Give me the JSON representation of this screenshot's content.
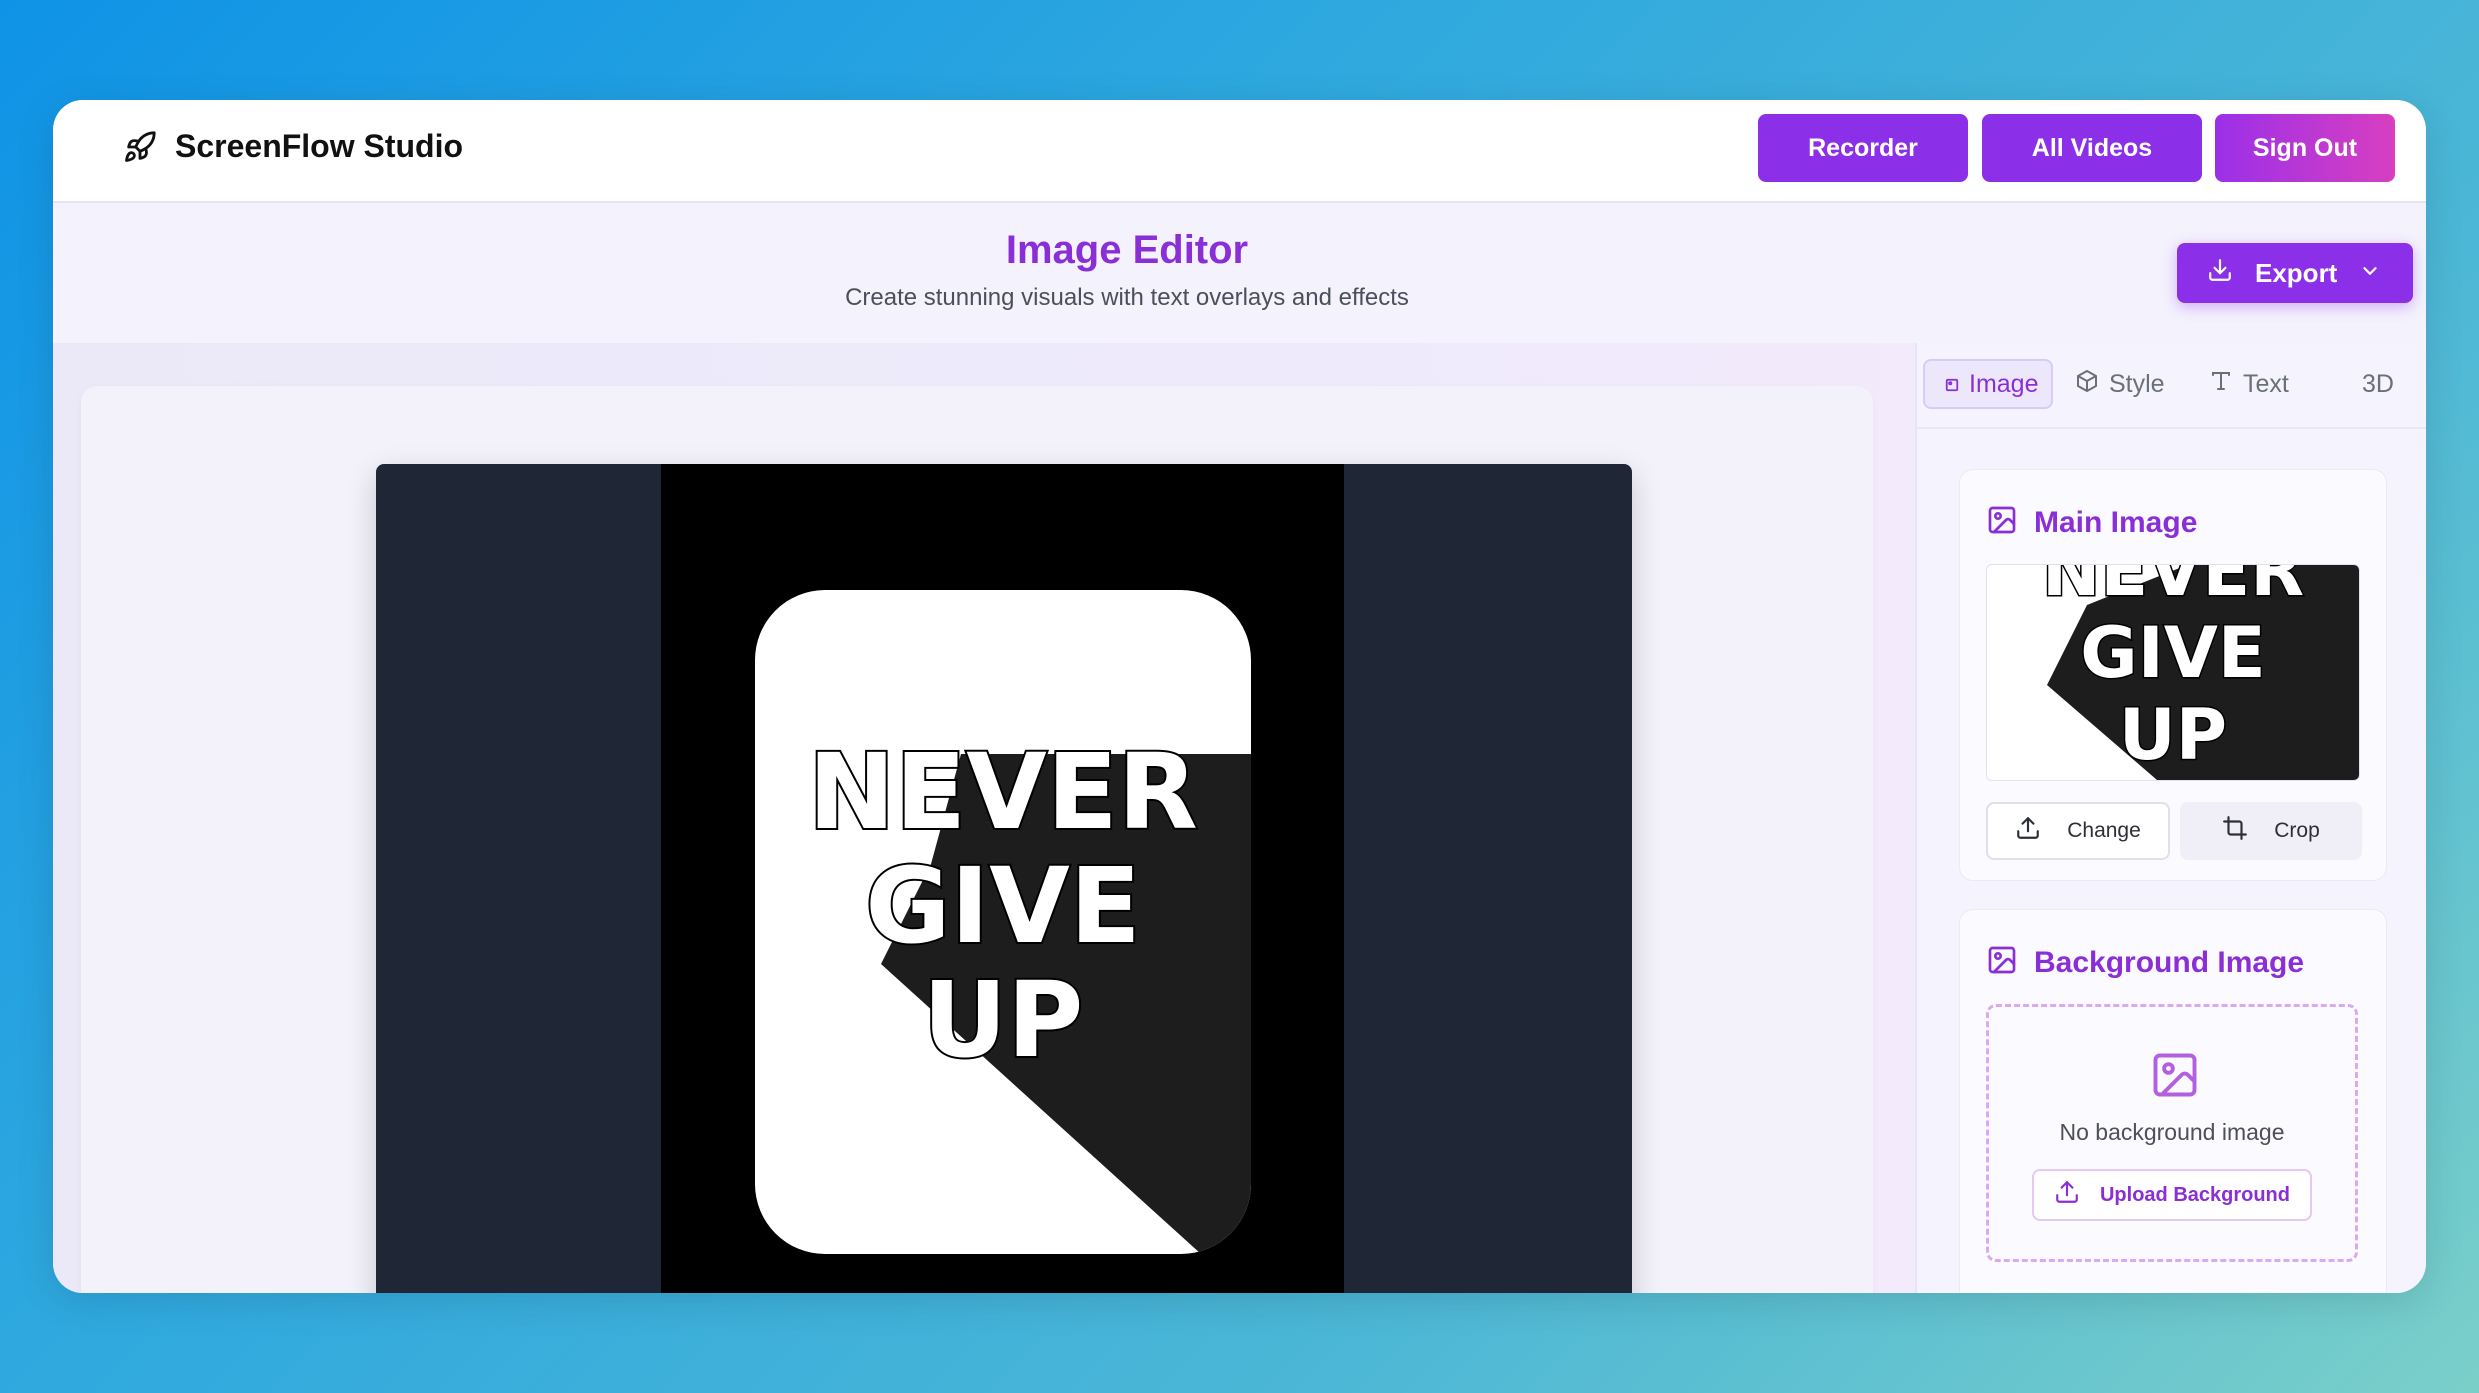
{
  "app": {
    "name": "ScreenFlow Studio",
    "icon": "rocket-icon"
  },
  "nav": {
    "recorder": "Recorder",
    "all_videos": "All Videos",
    "sign_out": "Sign Out"
  },
  "header": {
    "title": "Image Editor",
    "subtitle": "Create stunning visuals with text overlays and effects",
    "export_label": "Export"
  },
  "preview": {
    "line1": "NEVER",
    "line2": "GIVE",
    "line3": "UP"
  },
  "tabs": [
    {
      "label": "Image",
      "icon": "image-icon",
      "active": true
    },
    {
      "label": "Style",
      "icon": "cube-icon",
      "active": false
    },
    {
      "label": "Text",
      "icon": "text-icon",
      "active": false
    },
    {
      "label": "3D",
      "active": false
    }
  ],
  "main_image": {
    "title": "Main Image",
    "change_label": "Change",
    "crop_label": "Crop"
  },
  "background_image": {
    "title": "Background Image",
    "empty_text": "No background image",
    "upload_label": "Upload Background"
  },
  "colors": {
    "accent": "#8b2fe8",
    "title": "#8a2fd6",
    "signout_gradient_end": "#d83fc0",
    "canvas_frame": "#1f2737"
  }
}
